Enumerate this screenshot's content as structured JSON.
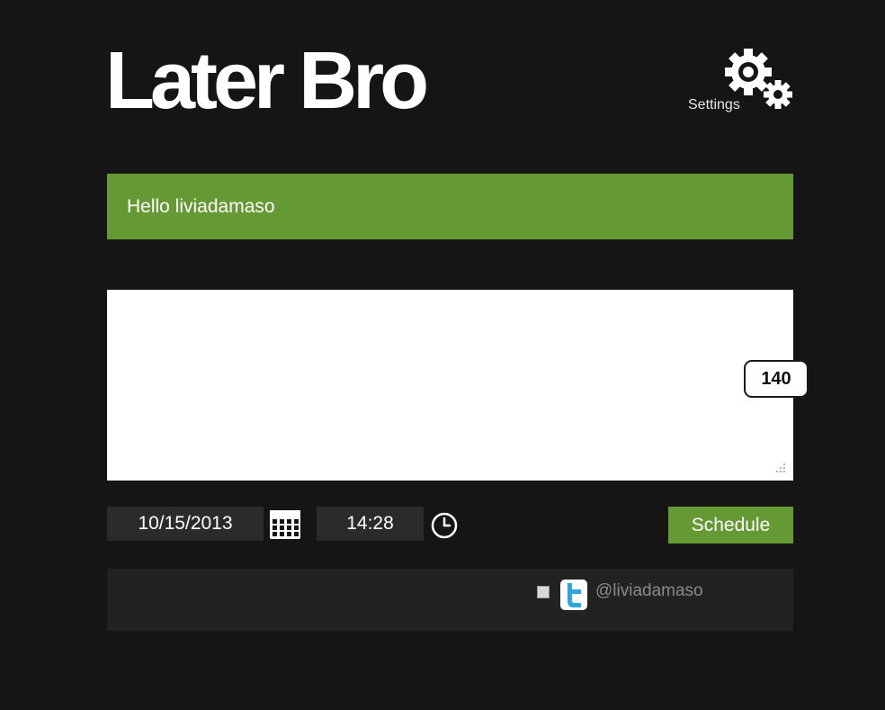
{
  "header": {
    "logo_text": "Later Bro",
    "settings_label": "Settings"
  },
  "greeting": {
    "text": "Hello liviadamaso"
  },
  "composer": {
    "value": "",
    "char_remaining": "140"
  },
  "schedule": {
    "date_value": "10/15/2013",
    "time_value": "14:28",
    "button_label": "Schedule"
  },
  "accounts": [
    {
      "service_icon": "twitter-icon",
      "handle": "@liviadamaso",
      "checked": false
    }
  ],
  "colors": {
    "background": "#151515",
    "accent_green": "#659933",
    "panel": "#222222",
    "field": "#2b2b2b",
    "twitter_blue": "#2fa5e0"
  }
}
